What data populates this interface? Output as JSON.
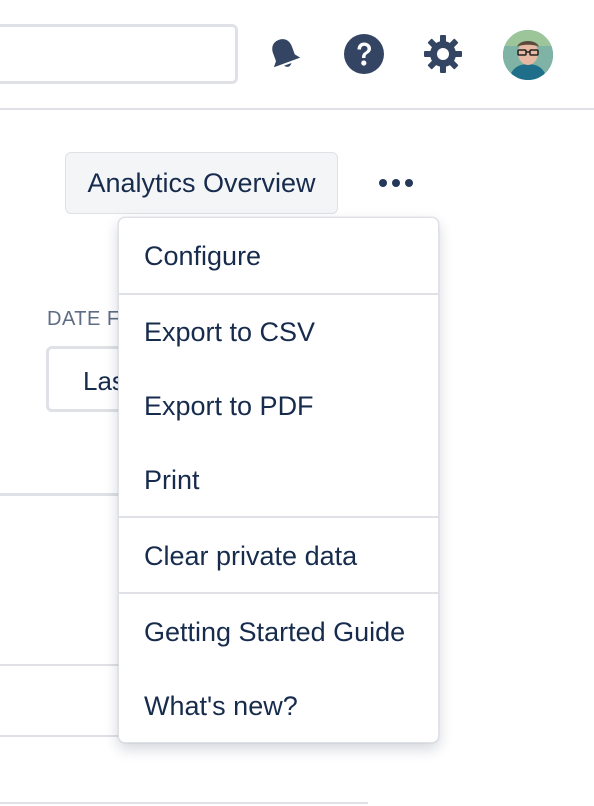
{
  "header": {
    "search_value": "",
    "icons": [
      "bell-icon",
      "help-icon",
      "gear-icon",
      "avatar"
    ]
  },
  "toolbar": {
    "overview_label": "Analytics Overview",
    "more_icon": "more-horizontal-icon"
  },
  "filter": {
    "date_label": "DATE F",
    "date_value": "Las"
  },
  "menu": {
    "items": [
      "Configure",
      "Export to CSV",
      "Export to PDF",
      "Print",
      "Clear private data",
      "Getting Started Guide",
      "What's new?"
    ]
  },
  "colors": {
    "text": "#172b4d",
    "border": "#dfe1e6",
    "button_bg": "#f4f5f7",
    "icon": "#344563"
  }
}
